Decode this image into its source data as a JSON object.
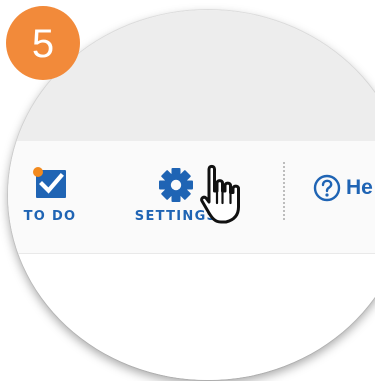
{
  "step": {
    "number": "5",
    "color": "#f28a3a"
  },
  "toolbar": {
    "items": [
      {
        "label": "TO DO",
        "icon": "checkbox-check-icon",
        "has_notification_dot": true
      },
      {
        "label": "SETTINGS",
        "icon": "gear-icon"
      }
    ],
    "help": {
      "label": "He",
      "icon": "question-circle-icon"
    }
  },
  "cursor": {
    "icon": "pointing-hand-cursor-icon"
  },
  "colors": {
    "primary_blue": "#1f64b4",
    "notification_dot": "#f28a1e",
    "header_gray": "#ededed",
    "toolbar_bg": "#fafafa"
  }
}
